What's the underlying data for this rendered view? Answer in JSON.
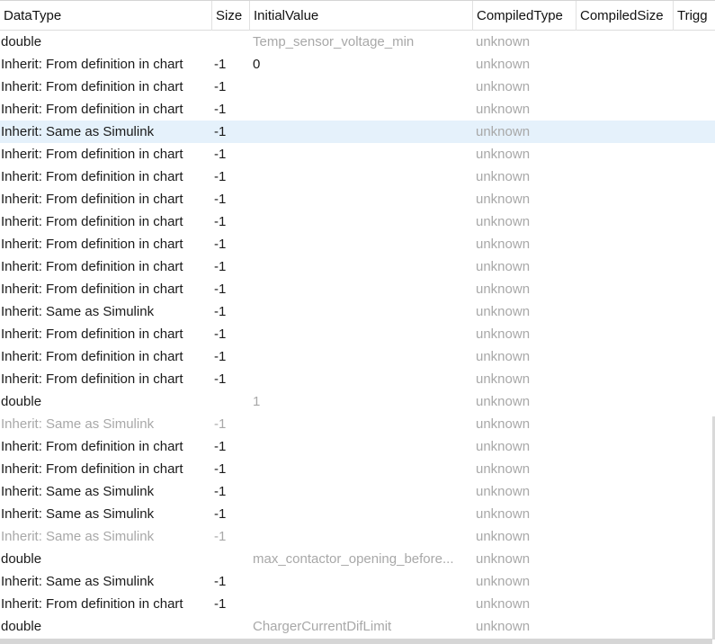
{
  "columns": [
    "DataType",
    "Size",
    "InitialValue",
    "CompiledType",
    "CompiledSize",
    "Trigg"
  ],
  "rows": [
    {
      "type": "double",
      "size": "",
      "init": "Temp_sensor_voltage_min",
      "ctype": "unknown",
      "init_muted": true
    },
    {
      "type": "Inherit: From definition in chart",
      "size": "-1",
      "init": "0",
      "ctype": "unknown"
    },
    {
      "type": "Inherit: From definition in chart",
      "size": "-1",
      "init": "",
      "ctype": "unknown"
    },
    {
      "type": "Inherit: From definition in chart",
      "size": "-1",
      "init": "",
      "ctype": "unknown"
    },
    {
      "type": "Inherit: Same as Simulink",
      "size": "-1",
      "init": "",
      "ctype": "unknown",
      "selected": true
    },
    {
      "type": "Inherit: From definition in chart",
      "size": "-1",
      "init": "",
      "ctype": "unknown"
    },
    {
      "type": "Inherit: From definition in chart",
      "size": "-1",
      "init": "",
      "ctype": "unknown"
    },
    {
      "type": "Inherit: From definition in chart",
      "size": "-1",
      "init": "",
      "ctype": "unknown"
    },
    {
      "type": "Inherit: From definition in chart",
      "size": "-1",
      "init": "",
      "ctype": "unknown"
    },
    {
      "type": "Inherit: From definition in chart",
      "size": "-1",
      "init": "",
      "ctype": "unknown"
    },
    {
      "type": "Inherit: From definition in chart",
      "size": "-1",
      "init": "",
      "ctype": "unknown"
    },
    {
      "type": "Inherit: From definition in chart",
      "size": "-1",
      "init": "",
      "ctype": "unknown"
    },
    {
      "type": "Inherit: Same as Simulink",
      "size": "-1",
      "init": "",
      "ctype": "unknown"
    },
    {
      "type": "Inherit: From definition in chart",
      "size": "-1",
      "init": "",
      "ctype": "unknown"
    },
    {
      "type": "Inherit: From definition in chart",
      "size": "-1",
      "init": "",
      "ctype": "unknown"
    },
    {
      "type": "Inherit: From definition in chart",
      "size": "-1",
      "init": "",
      "ctype": "unknown"
    },
    {
      "type": "double",
      "size": "",
      "init": "1",
      "ctype": "unknown",
      "init_muted": true
    },
    {
      "type": "Inherit: Same as Simulink",
      "size": "-1",
      "init": "",
      "ctype": "unknown",
      "muted": true
    },
    {
      "type": "Inherit: From definition in chart",
      "size": "-1",
      "init": "",
      "ctype": "unknown"
    },
    {
      "type": "Inherit: From definition in chart",
      "size": "-1",
      "init": "",
      "ctype": "unknown"
    },
    {
      "type": "Inherit: Same as Simulink",
      "size": "-1",
      "init": "",
      "ctype": "unknown"
    },
    {
      "type": "Inherit: Same as Simulink",
      "size": "-1",
      "init": "",
      "ctype": "unknown"
    },
    {
      "type": "Inherit: Same as Simulink",
      "size": "-1",
      "init": "",
      "ctype": "unknown",
      "muted": true
    },
    {
      "type": "double",
      "size": "",
      "init": "max_contactor_opening_before...",
      "ctype": "unknown",
      "init_muted": true
    },
    {
      "type": "Inherit: Same as Simulink",
      "size": "-1",
      "init": "",
      "ctype": "unknown"
    },
    {
      "type": "Inherit: From definition in chart",
      "size": "-1",
      "init": "",
      "ctype": "unknown"
    },
    {
      "type": "double",
      "size": "",
      "init": "ChargerCurrentDifLimit",
      "ctype": "unknown",
      "init_muted": true
    }
  ]
}
